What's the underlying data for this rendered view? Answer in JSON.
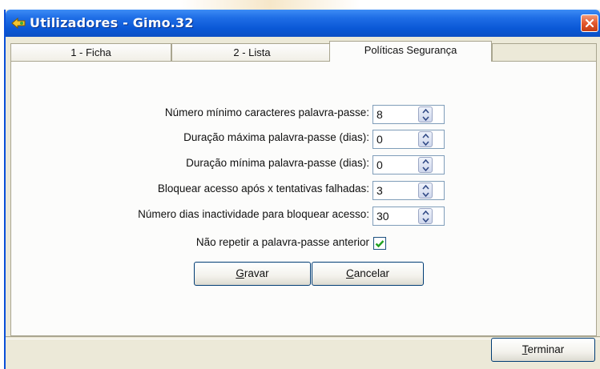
{
  "window": {
    "title": "Utilizadores - Gimo.32"
  },
  "tabs": [
    {
      "label": "1 - Ficha",
      "active": false
    },
    {
      "label": "2 - Lista",
      "active": false
    },
    {
      "label": "Políticas Segurança",
      "active": true
    }
  ],
  "policies": {
    "fields": [
      {
        "label": "Número mínimo caracteres palavra-passe:",
        "value": "8"
      },
      {
        "label": "Duração máxima palavra-passe (dias):",
        "value": "0"
      },
      {
        "label": "Duração mínima palavra-passe (dias):",
        "value": "0"
      },
      {
        "label": "Bloquear acesso após x tentativas falhadas:",
        "value": "3"
      },
      {
        "label": "Número dias inactividade para bloquear acesso:",
        "value": "30"
      }
    ],
    "no_repeat_label": "Não repetir a palavra-passe anterior",
    "no_repeat_checked": true
  },
  "buttons": {
    "save": {
      "mnemonic": "G",
      "rest": "ravar"
    },
    "cancel": {
      "mnemonic": "C",
      "rest": "ancelar"
    },
    "finish": {
      "mnemonic": "T",
      "rest": "erminar"
    }
  },
  "colors": {
    "titlebar": "#0a58d6",
    "window_bg": "#ece9d8",
    "close": "#e3582e",
    "check": "#21a121"
  }
}
